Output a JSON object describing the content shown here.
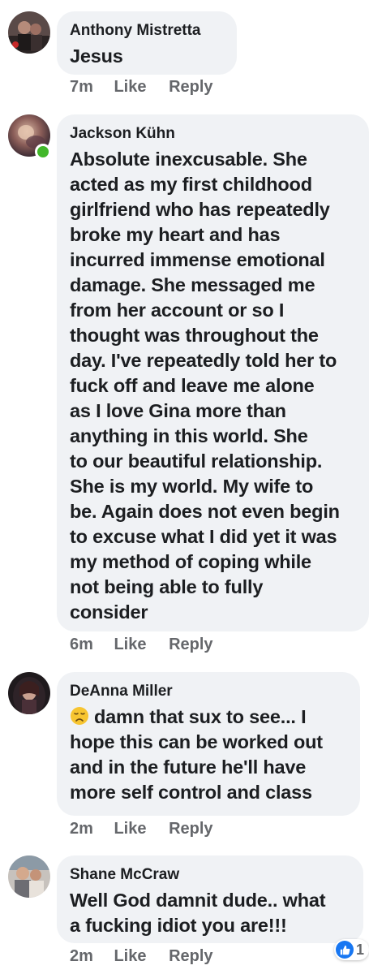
{
  "colors": {
    "bubble": "#f0f2f5",
    "meta_text": "#65676b",
    "online": "#42b72a",
    "like_blue": "#1877f2"
  },
  "comments": [
    {
      "author": "Anthony Mistretta",
      "text": "Jesus",
      "time": "7m",
      "like_label": "Like",
      "reply_label": "Reply"
    },
    {
      "author": "Jackson Kühn",
      "text": "Absolute inexcusable. She\nacted as my first childhood\ngirlfriend who has repeatedly\nbroke my heart and has\nincurred immense emotional\ndamage. She messaged me\nfrom her account or so I\nthought was throughout the\nday. I've repeatedly told her to\nfuck off and leave me alone\nas I love Gina more than\nanything in this world. She\nto our beautiful relationship.\nShe is my world. My wife to\nbe. Again does not even begin\nto excuse what I did yet it was\nmy method of coping while\nnot being able to fully\nconsider",
      "time": "6m",
      "like_label": "Like",
      "reply_label": "Reply",
      "online": true
    },
    {
      "author": "DeAnna Miller",
      "emoji": "disappointed-face-icon",
      "text": "damn that sux to see... I\nhope this can be worked out\nand in the future he'll have\nmore self control and class",
      "time": "2m",
      "like_label": "Like",
      "reply_label": "Reply"
    },
    {
      "author": "Shane McCraw",
      "text": "Well God damnit dude.. what\na fucking idiot you are!!!",
      "time": "2m",
      "like_label": "Like",
      "reply_label": "Reply",
      "reaction": {
        "icon": "thumbs-up-icon",
        "count": "1"
      }
    }
  ]
}
